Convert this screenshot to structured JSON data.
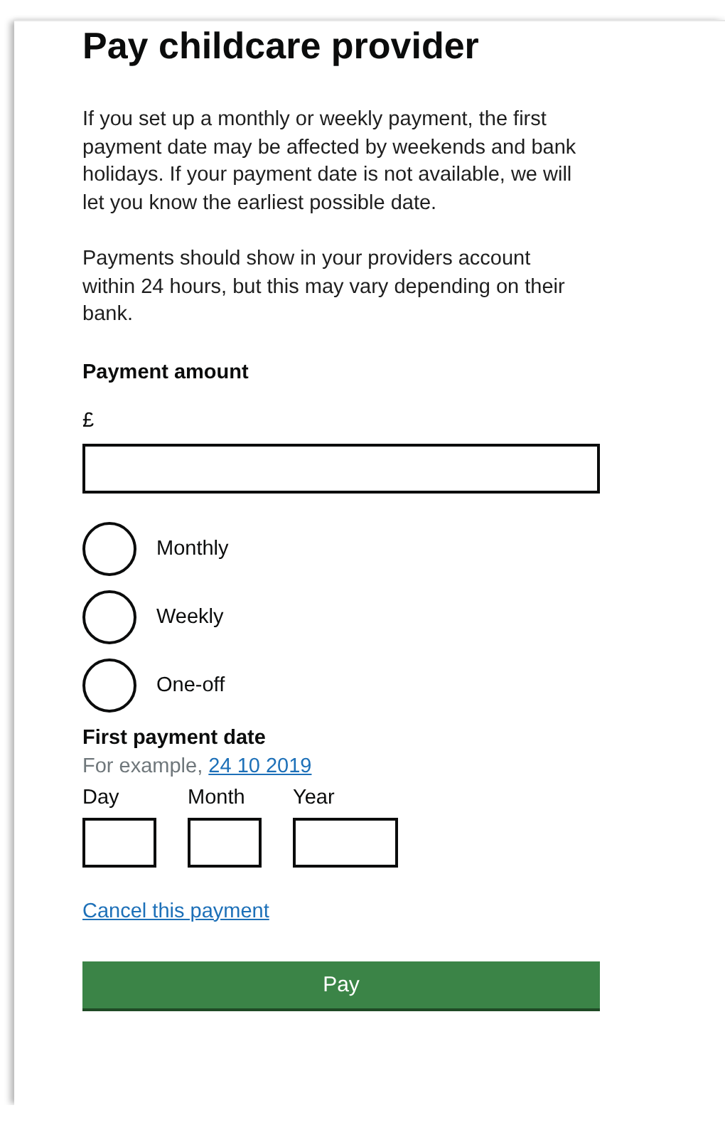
{
  "heading": "Pay childcare provider",
  "paragraphs": [
    "If you set up a monthly or weekly payment, the first payment date may be affected by weekends and bank holidays. If your payment date is not available, we will let you know the earliest possible date.",
    "Payments should show in your providers account within 24 hours, but this may vary depending on their bank."
  ],
  "amount": {
    "label": "Payment amount",
    "prefix": "£"
  },
  "frequency": [
    {
      "label": "Monthly",
      "selected": false
    },
    {
      "label": "Weekly",
      "selected": false
    },
    {
      "label": "One-off",
      "selected": false
    }
  ],
  "first_payment_date": {
    "label": "First payment date",
    "hint": "For example,",
    "example": "24 10 2019",
    "fields": [
      {
        "label": "Day",
        "kind": "short"
      },
      {
        "label": "Month",
        "kind": "short"
      },
      {
        "label": "Year",
        "kind": "long"
      }
    ]
  },
  "cancel_link": "Cancel this payment",
  "submit": "Pay"
}
